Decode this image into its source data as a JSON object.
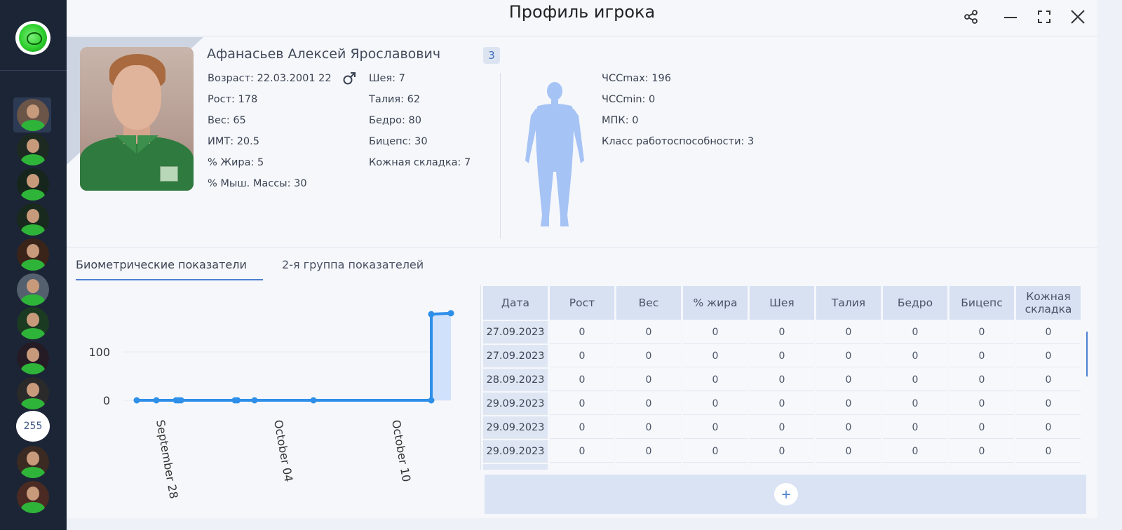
{
  "window": {
    "title": "Профиль игрока",
    "controls": [
      "share-icon",
      "minimize-icon",
      "fullscreen-icon",
      "close-icon"
    ]
  },
  "sidebar": {
    "badge_count": "255"
  },
  "player": {
    "name": "Афанасьев Алексей Ярославович",
    "level": "3",
    "age": "Возраст: 22.03.2001 22",
    "height": "Рост: 178",
    "weight": "Вес: 65",
    "bmi": "ИМТ: 20.5",
    "fat": "% Жира: 5",
    "muscle": "% Мыш. Массы: 30",
    "neck": "Шея: 7",
    "waist": "Талия: 62",
    "hip": "Бедро: 80",
    "biceps": "Бицепс: 30",
    "skinfold": "Кожная складка: 7",
    "hr_max": "ЧССmax: 196",
    "hr_min": "ЧССmin: 0",
    "vo2": "МПК: 0",
    "work_class": "Класс работоспособности: 3"
  },
  "tabs": [
    {
      "label": "Биометрические показатели",
      "active": true
    },
    {
      "label": "2-я группа показателей",
      "active": false
    }
  ],
  "chart_data": {
    "type": "line",
    "x": [
      "2023-09-27",
      "2023-09-28",
      "2023-09-29",
      "2023-09-29",
      "2023-09-29",
      "2023-10-02",
      "2023-10-02",
      "2023-10-03",
      "2023-10-06",
      "2023-10-12",
      "2023-10-12",
      "2023-10-13"
    ],
    "values": [
      0,
      0,
      0,
      0,
      0,
      0,
      0,
      0,
      0,
      0,
      178,
      180
    ],
    "ylim": [
      0,
      190
    ],
    "yticks": [
      "0",
      "100"
    ],
    "xticks": [
      "September 28",
      "October 04",
      "October 10"
    ]
  },
  "table": {
    "headers": [
      "Дата",
      "Рост",
      "Вес",
      "% жира",
      "Шея",
      "Талия",
      "Бедро",
      "Бицепс",
      "Кожная складка"
    ],
    "rows": [
      [
        "27.09.2023",
        "0",
        "0",
        "0",
        "0",
        "0",
        "0",
        "0",
        "0"
      ],
      [
        "27.09.2023",
        "0",
        "0",
        "0",
        "0",
        "0",
        "0",
        "0",
        "0"
      ],
      [
        "28.09.2023",
        "0",
        "0",
        "0",
        "0",
        "0",
        "0",
        "0",
        "0"
      ],
      [
        "29.09.2023",
        "0",
        "0",
        "0",
        "0",
        "0",
        "0",
        "0",
        "0"
      ],
      [
        "29.09.2023",
        "0",
        "0",
        "0",
        "0",
        "0",
        "0",
        "0",
        "0"
      ],
      [
        "29.09.2023",
        "0",
        "0",
        "0",
        "0",
        "0",
        "0",
        "0",
        "0"
      ]
    ]
  },
  "add_button_label": "+"
}
